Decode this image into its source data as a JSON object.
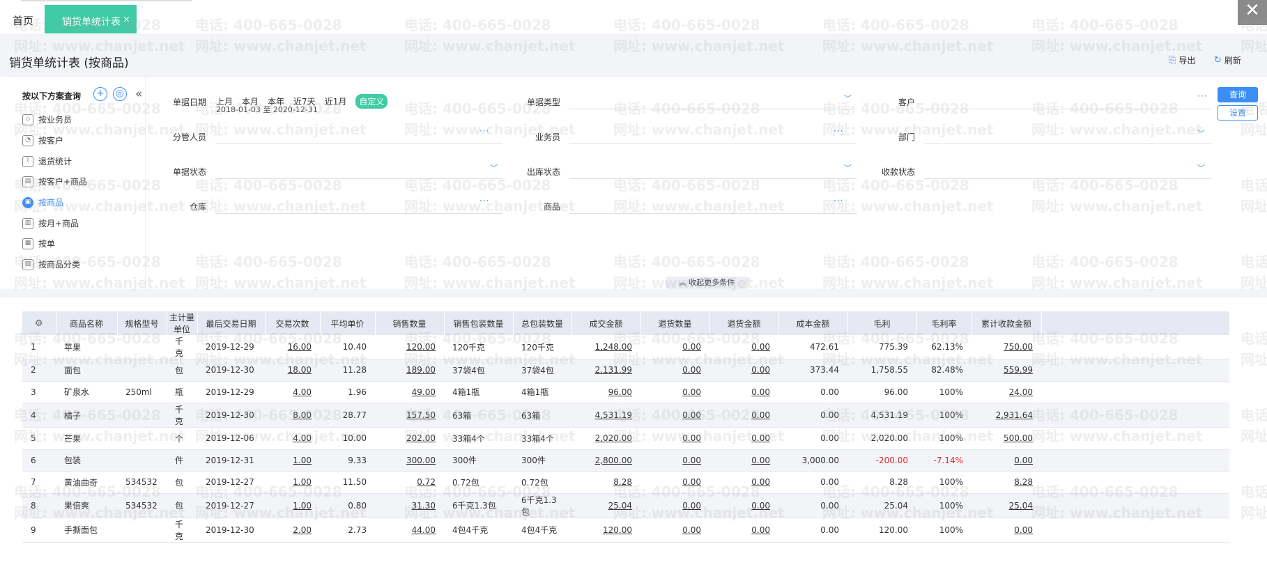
{
  "tabs": {
    "home": "首页",
    "active": "销货单统计表",
    "close": "×"
  },
  "window_close": "✕",
  "header": {
    "title": "销货单统计表 (按商品)",
    "export": "导出",
    "refresh": "刷新"
  },
  "nav": {
    "heading": "按以下方案查询",
    "items": [
      "按业务员",
      "按客户",
      "退货统计",
      "按客户+商品",
      "按商品",
      "按月+商品",
      "按单",
      "按商品分类"
    ],
    "active_index": 4
  },
  "filters": {
    "date_label": "单据日期",
    "quick": [
      "上月",
      "本月",
      "本年",
      "近7天",
      "近1月"
    ],
    "custom": "自定义",
    "range": "2018-01-03 至 2020-12-31",
    "doc_type": "单据类型",
    "customer": "客户",
    "manager": "分管人员",
    "salesman": "业务员",
    "dept": "部门",
    "doc_status": "单据状态",
    "out_status": "出库状态",
    "pay_status": "收款状态",
    "warehouse": "仓库",
    "product": "商品",
    "query_btn": "查询",
    "setting_btn": "设置",
    "more": "收起更多条件"
  },
  "table": {
    "headers": [
      "商品名称",
      "规格型号",
      "主计量单位",
      "最后交易日期",
      "交易次数",
      "平均单价",
      "销售数量",
      "销售包装数量",
      "总包装数量",
      "成交金额",
      "退货数量",
      "退货金额",
      "成本金额",
      "毛利",
      "毛利率",
      "累计收款金额"
    ],
    "rows": [
      [
        "1",
        "苹果",
        "",
        "千克",
        "2019-12-29",
        "16.00",
        "10.40",
        "120.00",
        "120千克",
        "120千克",
        "1,248.00",
        "0.00",
        "0.00",
        "472.61",
        "775.39",
        "62.13%",
        "750.00"
      ],
      [
        "2",
        "面包",
        "",
        "包",
        "2019-12-30",
        "18.00",
        "11.28",
        "189.00",
        "37袋4包",
        "37袋4包",
        "2,131.99",
        "0.00",
        "0.00",
        "373.44",
        "1,758.55",
        "82.48%",
        "559.99"
      ],
      [
        "3",
        "矿泉水",
        "250ml",
        "瓶",
        "2019-12-29",
        "4.00",
        "1.96",
        "49.00",
        "4箱1瓶",
        "4箱1瓶",
        "96.00",
        "0.00",
        "0.00",
        "0.00",
        "96.00",
        "100%",
        "24.00"
      ],
      [
        "4",
        "橘子",
        "",
        "千克",
        "2019-12-30",
        "8.00",
        "28.77",
        "157.50",
        "63箱",
        "63箱",
        "4,531.19",
        "0.00",
        "0.00",
        "0.00",
        "4,531.19",
        "100%",
        "2,931.64"
      ],
      [
        "5",
        "芒果",
        "",
        "个",
        "2019-12-06",
        "4.00",
        "10.00",
        "202.00",
        "33箱4个",
        "33箱4个",
        "2,020.00",
        "0.00",
        "0.00",
        "0.00",
        "2,020.00",
        "100%",
        "500.00"
      ],
      [
        "6",
        "包装",
        "",
        "件",
        "2019-12-31",
        "1.00",
        "9.33",
        "300.00",
        "300件",
        "300件",
        "2,800.00",
        "0.00",
        "0.00",
        "3,000.00",
        "-200.00",
        "-7.14%",
        "0.00"
      ],
      [
        "7",
        "黄油曲奇",
        "534532",
        "包",
        "2019-12-27",
        "1.00",
        "11.50",
        "0.72",
        "0.72包",
        "0.72包",
        "8.28",
        "0.00",
        "0.00",
        "0.00",
        "8.28",
        "100%",
        "8.28"
      ],
      [
        "8",
        "果倍爽",
        "534532",
        "包",
        "2019-12-27",
        "1.00",
        "0.80",
        "31.30",
        "6千克1.3包",
        "6千克1.3包",
        "25.04",
        "0.00",
        "0.00",
        "0.00",
        "25.04",
        "100%",
        "25.04"
      ],
      [
        "9",
        "手撕面包",
        "",
        "千克",
        "2019-12-30",
        "2.00",
        "2.73",
        "44.00",
        "4包4千克",
        "4包4千克",
        "120.00",
        "0.00",
        "0.00",
        "0.00",
        "120.00",
        "100%",
        "0.00"
      ]
    ]
  },
  "watermark": {
    "phone": "电话: 400-665-0028",
    "site": "网址: www.chanjet.net"
  },
  "colors": {
    "accent_green": "#3ecba5",
    "accent_blue": "#3b8ef5",
    "negative_red": "#e5282e"
  }
}
